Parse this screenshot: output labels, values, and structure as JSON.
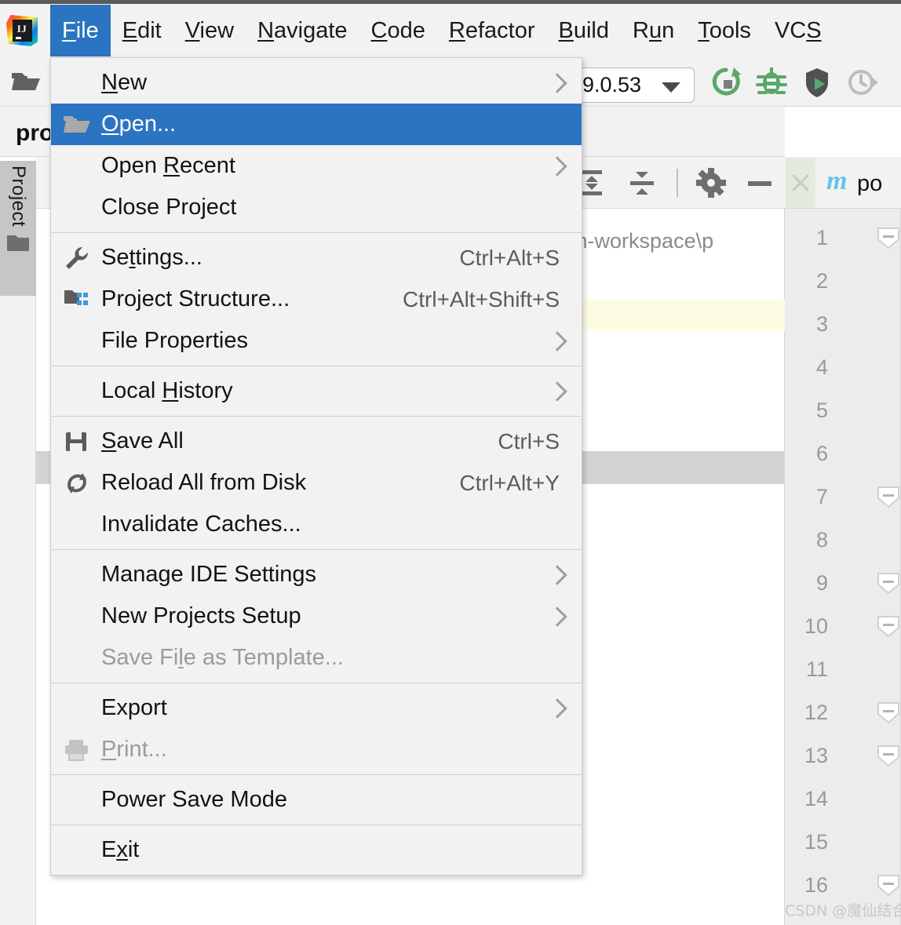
{
  "app": {
    "logo_text": "IJ",
    "logo_icon": "intellij-idea-logo"
  },
  "menubar": {
    "items": [
      {
        "label": "File",
        "mnemonic": "F",
        "active": true
      },
      {
        "label": "Edit",
        "mnemonic": "E",
        "active": false
      },
      {
        "label": "View",
        "mnemonic": "V",
        "active": false
      },
      {
        "label": "Navigate",
        "mnemonic": "N",
        "active": false
      },
      {
        "label": "Code",
        "mnemonic": "C",
        "active": false
      },
      {
        "label": "Refactor",
        "mnemonic": "R",
        "active": false
      },
      {
        "label": "Build",
        "mnemonic": "B",
        "active": false
      },
      {
        "label": "Run",
        "mnemonic": "u",
        "active": false
      },
      {
        "label": "Tools",
        "mnemonic": "T",
        "active": false
      },
      {
        "label": "VCS",
        "mnemonic": "S",
        "active": false
      }
    ]
  },
  "file_menu": {
    "groups": [
      {
        "items": [
          {
            "label": "New",
            "mnemonic": "N",
            "icon": null,
            "shortcut": null,
            "submenu": true,
            "selected": false,
            "disabled": false
          },
          {
            "label": "Open...",
            "mnemonic": "O",
            "icon": "open-folder-icon",
            "shortcut": null,
            "submenu": false,
            "selected": true,
            "disabled": false
          },
          {
            "label": "Open Recent",
            "mnemonic": "R",
            "icon": null,
            "shortcut": null,
            "submenu": true,
            "selected": false,
            "disabled": false
          },
          {
            "label": "Close Project",
            "mnemonic": null,
            "icon": null,
            "shortcut": null,
            "submenu": false,
            "selected": false,
            "disabled": false
          }
        ]
      },
      {
        "items": [
          {
            "label": "Settings...",
            "mnemonic": "t",
            "icon": "wrench-icon",
            "shortcut": "Ctrl+Alt+S",
            "submenu": false,
            "selected": false,
            "disabled": false
          },
          {
            "label": "Project Structure...",
            "mnemonic": null,
            "icon": "project-structure-icon",
            "shortcut": "Ctrl+Alt+Shift+S",
            "submenu": false,
            "selected": false,
            "disabled": false
          },
          {
            "label": "File Properties",
            "mnemonic": null,
            "icon": null,
            "shortcut": null,
            "submenu": true,
            "selected": false,
            "disabled": false
          }
        ]
      },
      {
        "items": [
          {
            "label": "Local History",
            "mnemonic": "H",
            "icon": null,
            "shortcut": null,
            "submenu": true,
            "selected": false,
            "disabled": false
          }
        ]
      },
      {
        "items": [
          {
            "label": "Save All",
            "mnemonic": "S",
            "icon": "save-icon",
            "shortcut": "Ctrl+S",
            "submenu": false,
            "selected": false,
            "disabled": false
          },
          {
            "label": "Reload All from Disk",
            "mnemonic": null,
            "icon": "reload-icon",
            "shortcut": "Ctrl+Alt+Y",
            "submenu": false,
            "selected": false,
            "disabled": false
          },
          {
            "label": "Invalidate Caches...",
            "mnemonic": null,
            "icon": null,
            "shortcut": null,
            "submenu": false,
            "selected": false,
            "disabled": false
          }
        ]
      },
      {
        "items": [
          {
            "label": "Manage IDE Settings",
            "mnemonic": null,
            "icon": null,
            "shortcut": null,
            "submenu": true,
            "selected": false,
            "disabled": false
          },
          {
            "label": "New Projects Setup",
            "mnemonic": null,
            "icon": null,
            "shortcut": null,
            "submenu": true,
            "selected": false,
            "disabled": false
          },
          {
            "label": "Save File as Template...",
            "mnemonic": "l",
            "icon": null,
            "shortcut": null,
            "submenu": false,
            "selected": false,
            "disabled": true
          }
        ]
      },
      {
        "items": [
          {
            "label": "Export",
            "mnemonic": null,
            "icon": null,
            "shortcut": null,
            "submenu": true,
            "selected": false,
            "disabled": false
          },
          {
            "label": "Print...",
            "mnemonic": "P",
            "icon": "printer-icon",
            "shortcut": null,
            "submenu": false,
            "selected": false,
            "disabled": true
          }
        ]
      },
      {
        "items": [
          {
            "label": "Power Save Mode",
            "mnemonic": null,
            "icon": null,
            "shortcut": null,
            "submenu": false,
            "selected": false,
            "disabled": false
          }
        ]
      },
      {
        "items": [
          {
            "label": "Exit",
            "mnemonic": "x",
            "icon": null,
            "shortcut": null,
            "submenu": false,
            "selected": false,
            "disabled": false
          }
        ]
      }
    ]
  },
  "toolbar": {
    "open_folder_icon": "open-folder-icon",
    "run_config": {
      "value": "9.0.53",
      "caret_icon": "chevron-down-icon"
    },
    "actions": [
      {
        "name": "rerun-icon",
        "color": "#59a869"
      },
      {
        "name": "debug-icon",
        "color": "#59a869"
      },
      {
        "name": "run-with-coverage-icon",
        "color": "#59a869"
      },
      {
        "name": "profiler-icon",
        "color": "#b8b8b8"
      }
    ]
  },
  "project_panel": {
    "title": "pro",
    "tool_window_tab": {
      "label": "Project",
      "icon": "folder-icon"
    },
    "toolbar_actions": [
      {
        "name": "expand-all-icon"
      },
      {
        "name": "collapse-all-icon"
      },
      {
        "name": "settings-gear-icon"
      },
      {
        "name": "hide-icon"
      }
    ],
    "path_text": "aven-workspace\\p"
  },
  "editor": {
    "tab": {
      "close_icon": "close-icon",
      "file_icon": "maven-m-icon",
      "icon_letter": "m",
      "label": "po"
    },
    "line_numbers": [
      "1",
      "2",
      "3",
      "4",
      "5",
      "6",
      "7",
      "8",
      "9",
      "10",
      "11",
      "12",
      "13",
      "14",
      "15",
      "16"
    ],
    "fold_lines": [
      "1",
      "7",
      "9",
      "10",
      "12",
      "13",
      "16"
    ]
  },
  "watermark": {
    "text": "CSDN @魔仙结合"
  },
  "colors": {
    "accent_blue": "#2a74c1",
    "chrome_grey": "#f2f2f2",
    "gutter_grey": "#ececec",
    "maven_blue": "#63c3e8",
    "run_green": "#59a869",
    "disabled_grey": "#9b9b9b"
  }
}
